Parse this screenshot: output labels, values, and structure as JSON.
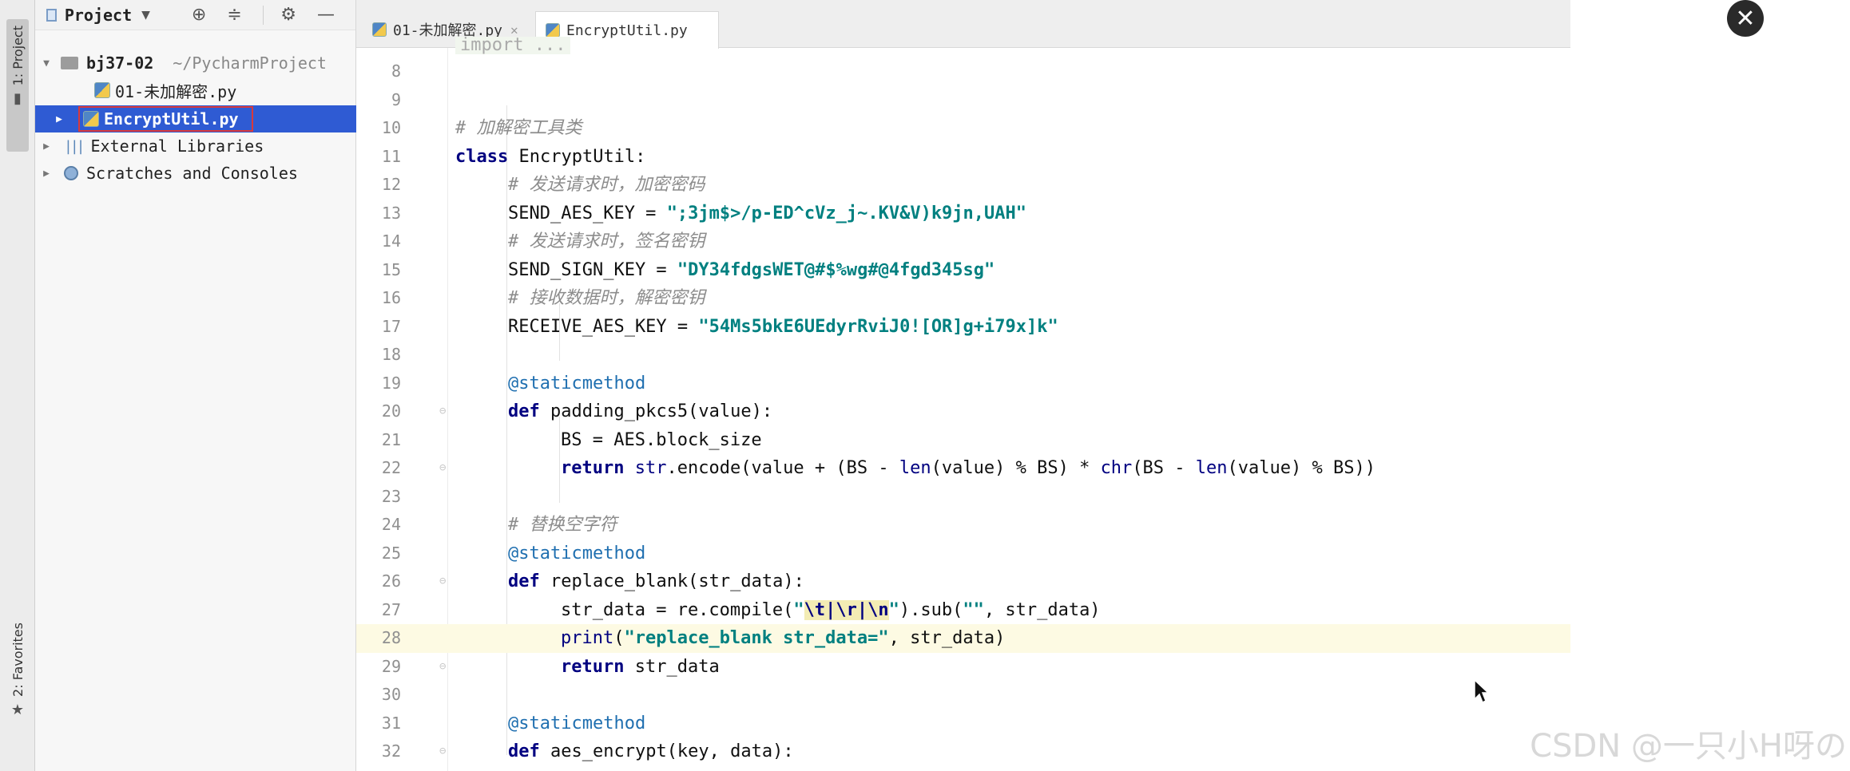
{
  "tool_strip": {
    "project_tab": "1: Project",
    "favorites_tab": "2: Favorites"
  },
  "project_panel": {
    "title": "Project",
    "tree": [
      {
        "label": "bj37-02",
        "path": "~/PycharmProject"
      },
      {
        "label": "01-未加解密.py"
      },
      {
        "label": "EncryptUtil.py",
        "selected": true
      },
      {
        "label": "External Libraries"
      },
      {
        "label": "Scratches and Consoles"
      }
    ]
  },
  "editor": {
    "tabs": [
      {
        "label": "01-未加解密.py",
        "active": false
      },
      {
        "label": "EncryptUtil.py",
        "active": true
      }
    ],
    "top_fragment": "import ...",
    "line_numbers": [
      "8",
      "9",
      "10",
      "11",
      "12",
      "13",
      "14",
      "15",
      "16",
      "17",
      "18",
      "19",
      "20",
      "21",
      "22",
      "23",
      "24",
      "25",
      "26",
      "27",
      "28",
      "29",
      "30",
      "31",
      "32"
    ],
    "code": {
      "c10": "# 加解密工具类",
      "c11_kw": "class",
      "c11_rest": " EncryptUtil:",
      "c12": "# 发送请求时，加密密码",
      "c13_var": "SEND_AES_KEY = ",
      "c13_str": "\";3jm$>/p-ED^cVz_j~.KV&V)k9jn,UAH\"",
      "c14": "# 发送请求时，签名密钥",
      "c15_var": "SEND_SIGN_KEY = ",
      "c15_str": "\"DY34fdgsWET@#$%wg#@4fgd345sg\"",
      "c16": "# 接收数据时，解密密钥",
      "c17_var": "RECEIVE_AES_KEY = ",
      "c17_str": "\"54Ms5bkE6UEdyrRviJ0![OR]g+i79x]k\"",
      "c19": "@staticmethod",
      "c20_kw": "def",
      "c20_rest": " padding_pkcs5(value):",
      "c21": "BS = AES.block_size",
      "c22_kw": "return",
      "c22_a": " ",
      "c22_str": "str",
      "c22_b": ".encode(value + (BS - ",
      "c22_len1": "len",
      "c22_c": "(value) % BS) * ",
      "c22_chr": "chr",
      "c22_d": "(BS - ",
      "c22_len2": "len",
      "c22_e": "(value) % BS))",
      "c24": "# 替换空字符",
      "c25": "@staticmethod",
      "c26_kw": "def",
      "c26_rest": " replace_blank(str_data):",
      "c27_a": "str_data = re.compile(",
      "c27_q1": "\"",
      "c27_esc": "\\t|\\r|\\n",
      "c27_q2": "\"",
      "c27_b": ").sub(",
      "c27_empty": "\"\"",
      "c27_c": ", str_data)",
      "c28_print": "print",
      "c28_a": "(",
      "c28_str": "\"replace_blank str_data=\"",
      "c28_b": ", str_data)",
      "c29_kw": "return",
      "c29_rest": " str_data",
      "c31": "@staticmethod",
      "c32_kw": "def",
      "c32_rest": " aes_encrypt(key, data):"
    }
  },
  "overlay": {
    "close_symbol": "✕",
    "watermark": "CSDN @一只小H呀の"
  },
  "icons": [
    "project-icon",
    "locate-icon",
    "collapse-icon",
    "gear-icon",
    "hide-icon",
    "folder-icon",
    "python-file-icon",
    "library-icon",
    "scratches-icon",
    "star-icon",
    "close-icon",
    "cursor-icon"
  ]
}
